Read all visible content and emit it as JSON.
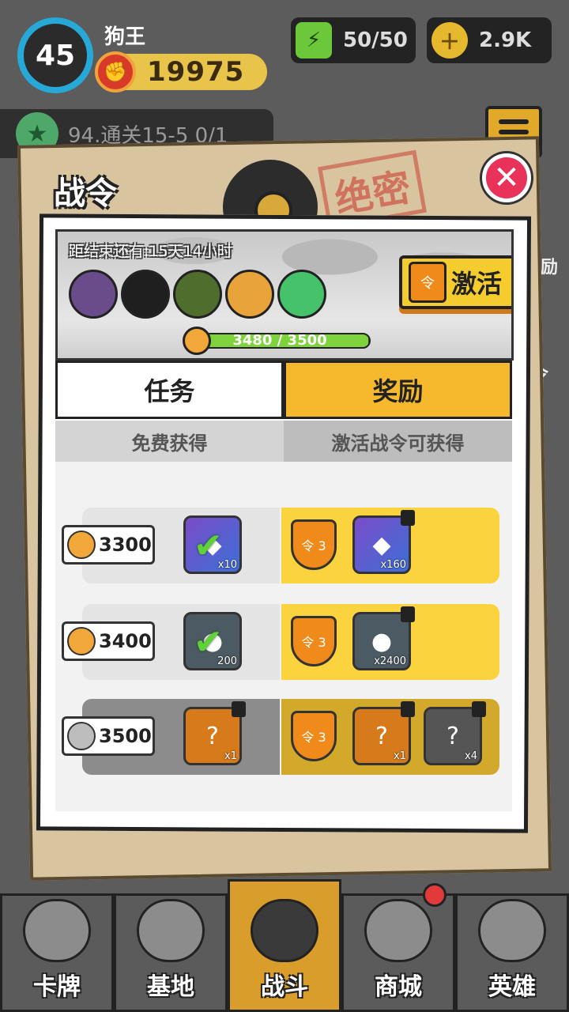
{
  "hud": {
    "level": "45",
    "player_name": "狗王",
    "power": "19975",
    "energy": "50/50",
    "gold": "2.9K",
    "stage_progress": "94.通关15-5  0/1"
  },
  "panel": {
    "title": "战令",
    "countdown": "距结束还有:15天14小时",
    "activate_label": "激活",
    "badge_text": "令",
    "progress_text": "3480 / 3500",
    "progress_fraction": 0.994,
    "tabs": [
      "任务",
      "奖励"
    ],
    "subheaders": [
      "免费获得",
      "激活战令可获得"
    ]
  },
  "rewards": [
    {
      "score": "3300",
      "free": {
        "type": "diamond",
        "qty": "x10",
        "claimed": true
      },
      "paid": [
        {
          "type": "token",
          "qty": "3"
        },
        {
          "type": "diamond",
          "qty": "x160",
          "locked": true
        }
      ]
    },
    {
      "score": "3400",
      "free": {
        "type": "gold",
        "qty": "200",
        "claimed": true
      },
      "paid": [
        {
          "type": "token",
          "qty": "3"
        },
        {
          "type": "gold",
          "qty": "x2400",
          "locked": true
        }
      ]
    },
    {
      "score": "3500",
      "free": {
        "type": "card",
        "qty": "x1",
        "locked": true
      },
      "paid": [
        {
          "type": "token",
          "qty": "3"
        },
        {
          "type": "card",
          "qty": "x1",
          "locked": true
        },
        {
          "type": "card2",
          "qty": "x4",
          "locked": true
        }
      ]
    }
  ],
  "side_tags": [
    "奖励",
    "令"
  ],
  "nav": {
    "items": [
      "卡牌",
      "基地",
      "战斗",
      "商城",
      "英雄"
    ],
    "active_index": 2
  },
  "colors": {
    "accent": "#f6b92d",
    "close": "#e8325a",
    "progress": "#7ed23c"
  }
}
